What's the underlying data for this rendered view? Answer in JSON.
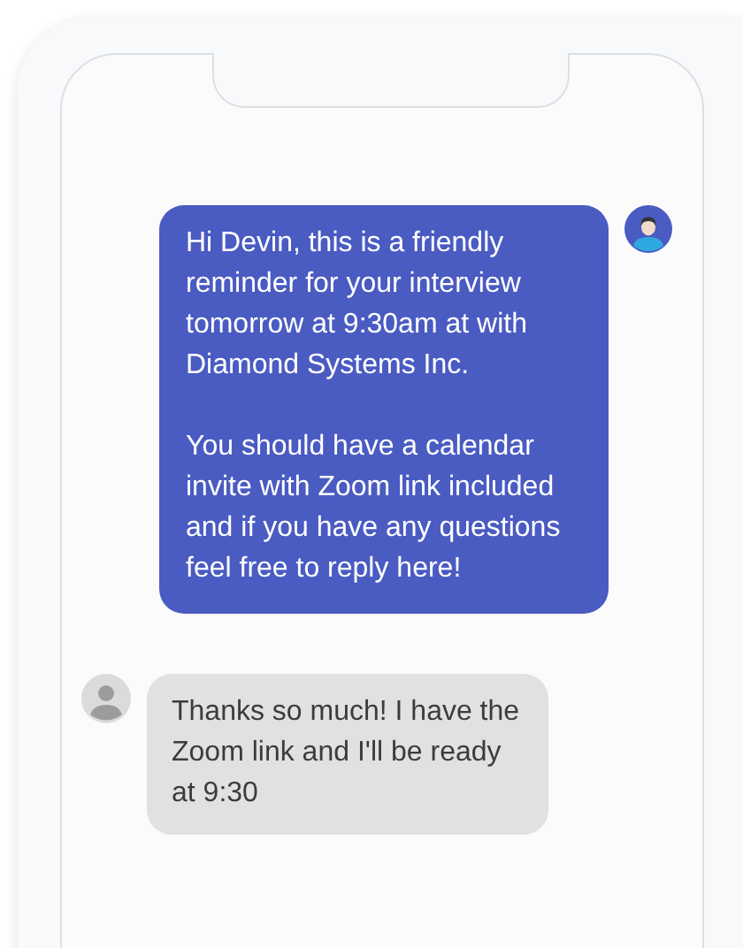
{
  "messages": [
    {
      "kind": "sent",
      "paragraphs": [
        "Hi Devin, this is a friendly reminder for your interview tomorrow at 9:30am at with Diamond Systems Inc.",
        "You should have a calendar invite with Zoom link included and if you have any questions feel free to reply here!"
      ]
    },
    {
      "kind": "received",
      "paragraphs": [
        "Thanks so much! I have the Zoom link and I'll be ready at 9:30"
      ]
    }
  ]
}
